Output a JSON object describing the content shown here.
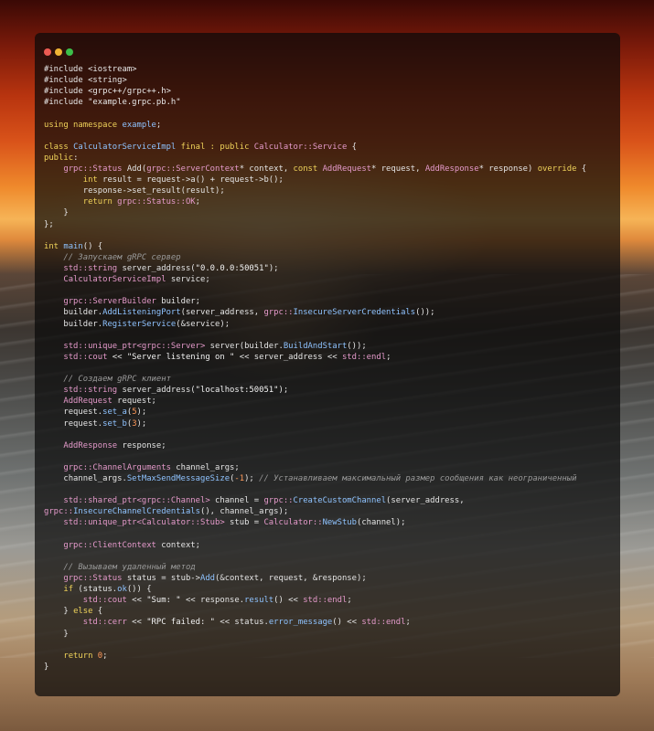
{
  "window": {
    "controls": [
      {
        "name": "close",
        "color": "#ec5b53"
      },
      {
        "name": "minimize",
        "color": "#f0b434"
      },
      {
        "name": "maximize",
        "color": "#3cbf4a"
      }
    ]
  },
  "code": {
    "lines": [
      [
        [
          "preproc",
          "#include <iostream>"
        ]
      ],
      [
        [
          "preproc",
          "#include <string>"
        ]
      ],
      [
        [
          "preproc",
          "#include <grpc++/grpc++.h>"
        ]
      ],
      [
        [
          "preproc",
          "#include \"example.grpc.pb.h\""
        ]
      ],
      [],
      [
        [
          "keyword",
          "using namespace "
        ],
        [
          "func",
          "example"
        ],
        [
          "default",
          ";"
        ]
      ],
      [],
      [
        [
          "keyword",
          "class "
        ],
        [
          "func",
          "CalculatorServiceImpl"
        ],
        [
          "keyword",
          " final : public "
        ],
        [
          "type",
          "Calculator::Service"
        ],
        [
          "default",
          " {"
        ]
      ],
      [
        [
          "keyword",
          "public"
        ],
        [
          "default",
          ":"
        ]
      ],
      [
        [
          "default",
          "    "
        ],
        [
          "type",
          "grpc::Status"
        ],
        [
          "default",
          " Add("
        ],
        [
          "type",
          "grpc::ServerContext"
        ],
        [
          "default",
          "* context, "
        ],
        [
          "keyword",
          "const "
        ],
        [
          "type",
          "AddRequest"
        ],
        [
          "default",
          "* request, "
        ],
        [
          "type",
          "AddResponse"
        ],
        [
          "default",
          "* response) "
        ],
        [
          "keyword",
          "override"
        ],
        [
          "default",
          " {"
        ]
      ],
      [
        [
          "default",
          "        "
        ],
        [
          "keyword",
          "int "
        ],
        [
          "default",
          "result = request->a() + request->b();"
        ]
      ],
      [
        [
          "default",
          "        response->set_result(result);"
        ]
      ],
      [
        [
          "default",
          "        "
        ],
        [
          "keyword",
          "return "
        ],
        [
          "type",
          "grpc::Status::OK"
        ],
        [
          "default",
          ";"
        ]
      ],
      [
        [
          "default",
          "    }"
        ]
      ],
      [
        [
          "default",
          "};"
        ]
      ],
      [],
      [
        [
          "keyword",
          "int "
        ],
        [
          "func",
          "main"
        ],
        [
          "default",
          "() {"
        ]
      ],
      [
        [
          "default",
          "    "
        ],
        [
          "comment",
          "// Запускаем gRPC сервер"
        ]
      ],
      [
        [
          "default",
          "    "
        ],
        [
          "type",
          "std::string"
        ],
        [
          "default",
          " server_address("
        ],
        [
          "string",
          "\"0.0.0.0:50051\""
        ],
        [
          "default",
          ");"
        ]
      ],
      [
        [
          "default",
          "    "
        ],
        [
          "type",
          "CalculatorServiceImpl"
        ],
        [
          "default",
          " service;"
        ]
      ],
      [],
      [
        [
          "default",
          "    "
        ],
        [
          "type",
          "grpc::ServerBuilder"
        ],
        [
          "default",
          " builder;"
        ]
      ],
      [
        [
          "default",
          "    builder."
        ],
        [
          "func",
          "AddListeningPort"
        ],
        [
          "default",
          "(server_address, "
        ],
        [
          "type",
          "grpc::"
        ],
        [
          "func",
          "InsecureServerCredentials"
        ],
        [
          "default",
          "());"
        ]
      ],
      [
        [
          "default",
          "    builder."
        ],
        [
          "func",
          "RegisterService"
        ],
        [
          "default",
          "(&service);"
        ]
      ],
      [],
      [
        [
          "default",
          "    "
        ],
        [
          "type",
          "std::unique_ptr<grpc::Server>"
        ],
        [
          "default",
          " server(builder."
        ],
        [
          "func",
          "BuildAndStart"
        ],
        [
          "default",
          "());"
        ]
      ],
      [
        [
          "default",
          "    "
        ],
        [
          "type",
          "std::cout"
        ],
        [
          "default",
          " << "
        ],
        [
          "string",
          "\"Server listening on \""
        ],
        [
          "default",
          " << server_address << "
        ],
        [
          "type",
          "std::endl"
        ],
        [
          "default",
          ";"
        ]
      ],
      [],
      [
        [
          "default",
          "    "
        ],
        [
          "comment",
          "// Создаем gRPC клиент"
        ]
      ],
      [
        [
          "default",
          "    "
        ],
        [
          "type",
          "std::string"
        ],
        [
          "default",
          " server_address("
        ],
        [
          "string",
          "\"localhost:50051\""
        ],
        [
          "default",
          ");"
        ]
      ],
      [
        [
          "default",
          "    "
        ],
        [
          "type",
          "AddRequest"
        ],
        [
          "default",
          " request;"
        ]
      ],
      [
        [
          "default",
          "    request."
        ],
        [
          "func",
          "set_a"
        ],
        [
          "default",
          "("
        ],
        [
          "number",
          "5"
        ],
        [
          "default",
          ");"
        ]
      ],
      [
        [
          "default",
          "    request."
        ],
        [
          "func",
          "set_b"
        ],
        [
          "default",
          "("
        ],
        [
          "number",
          "3"
        ],
        [
          "default",
          ");"
        ]
      ],
      [],
      [
        [
          "default",
          "    "
        ],
        [
          "type",
          "AddResponse"
        ],
        [
          "default",
          " response;"
        ]
      ],
      [],
      [
        [
          "default",
          "    "
        ],
        [
          "type",
          "grpc::ChannelArguments"
        ],
        [
          "default",
          " channel_args;"
        ]
      ],
      [
        [
          "default",
          "    channel_args."
        ],
        [
          "func",
          "SetMaxSendMessageSize"
        ],
        [
          "default",
          "("
        ],
        [
          "number",
          "-1"
        ],
        [
          "default",
          "); "
        ],
        [
          "comment",
          "// Устанавливаем максимальный размер сообщения как неограниченный"
        ]
      ],
      [],
      [
        [
          "default",
          "    "
        ],
        [
          "type",
          "std::shared_ptr<grpc::Channel>"
        ],
        [
          "default",
          " channel = "
        ],
        [
          "type",
          "grpc::"
        ],
        [
          "func",
          "CreateCustomChannel"
        ],
        [
          "default",
          "(server_address,"
        ]
      ],
      [
        [
          "type",
          "grpc::"
        ],
        [
          "func",
          "InsecureChannelCredentials"
        ],
        [
          "default",
          "(), channel_args);"
        ]
      ],
      [
        [
          "default",
          "    "
        ],
        [
          "type",
          "std::unique_ptr<Calculator::Stub>"
        ],
        [
          "default",
          " stub = "
        ],
        [
          "type",
          "Calculator::"
        ],
        [
          "func",
          "NewStub"
        ],
        [
          "default",
          "(channel);"
        ]
      ],
      [],
      [
        [
          "default",
          "    "
        ],
        [
          "type",
          "grpc::ClientContext"
        ],
        [
          "default",
          " context;"
        ]
      ],
      [],
      [
        [
          "default",
          "    "
        ],
        [
          "comment",
          "// Вызываем удаленный метод"
        ]
      ],
      [
        [
          "default",
          "    "
        ],
        [
          "type",
          "grpc::Status"
        ],
        [
          "default",
          " status = stub->"
        ],
        [
          "func",
          "Add"
        ],
        [
          "default",
          "(&context, request, &response);"
        ]
      ],
      [
        [
          "default",
          "    "
        ],
        [
          "keyword",
          "if "
        ],
        [
          "default",
          "(status."
        ],
        [
          "func",
          "ok"
        ],
        [
          "default",
          "()) {"
        ]
      ],
      [
        [
          "default",
          "        "
        ],
        [
          "type",
          "std::cout"
        ],
        [
          "default",
          " << "
        ],
        [
          "string",
          "\"Sum: \""
        ],
        [
          "default",
          " << response."
        ],
        [
          "func",
          "result"
        ],
        [
          "default",
          "() << "
        ],
        [
          "type",
          "std::endl"
        ],
        [
          "default",
          ";"
        ]
      ],
      [
        [
          "default",
          "    } "
        ],
        [
          "keyword",
          "else "
        ],
        [
          "default",
          "{"
        ]
      ],
      [
        [
          "default",
          "        "
        ],
        [
          "type",
          "std::cerr"
        ],
        [
          "default",
          " << "
        ],
        [
          "string",
          "\"RPC failed: \""
        ],
        [
          "default",
          " << status."
        ],
        [
          "func",
          "error_message"
        ],
        [
          "default",
          "() << "
        ],
        [
          "type",
          "std::endl"
        ],
        [
          "default",
          ";"
        ]
      ],
      [
        [
          "default",
          "    }"
        ]
      ],
      [],
      [
        [
          "default",
          "    "
        ],
        [
          "keyword",
          "return "
        ],
        [
          "number",
          "0"
        ],
        [
          "default",
          ";"
        ]
      ],
      [
        [
          "default",
          "}"
        ]
      ]
    ]
  }
}
